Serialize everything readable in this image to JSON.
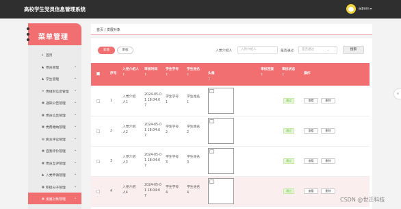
{
  "header": {
    "title": "高校学生党员信息管理系统",
    "user": "admin",
    "user_caret": "▾"
  },
  "sidebar": {
    "heading": "菜单管理",
    "items": [
      {
        "label": "首页",
        "icon": "home-icon",
        "glyph": "⌂",
        "chevron": ""
      },
      {
        "label": "党员管理",
        "icon": "user-icon",
        "glyph": "▲",
        "chevron": "⌄"
      },
      {
        "label": "学生管理",
        "icon": "user-icon",
        "glyph": "▲",
        "chevron": "⌄"
      },
      {
        "label": "党组织信息管理",
        "icon": "list-icon",
        "glyph": "≡",
        "chevron": "⌄"
      },
      {
        "label": "通知公告管理",
        "icon": "grid-icon",
        "glyph": "▦",
        "chevron": "⌄"
      },
      {
        "label": "党员信息管理",
        "icon": "grid-icon",
        "glyph": "▦",
        "chevron": "⌄"
      },
      {
        "label": "党费缴纳管理",
        "icon": "grid-icon",
        "glyph": "▦",
        "chevron": "⌄"
      },
      {
        "label": "民主评议管理",
        "icon": "doc-icon",
        "glyph": "▤",
        "chevron": "⌄"
      },
      {
        "label": "自我评价管理",
        "icon": "grid-icon",
        "glyph": "▦",
        "chevron": "⌄"
      },
      {
        "label": "党员互评管理",
        "icon": "grid-icon",
        "glyph": "▦",
        "chevron": "⌄"
      },
      {
        "label": "入党申请管理",
        "icon": "user-icon",
        "glyph": "▲",
        "chevron": "⌄"
      },
      {
        "label": "积极分子管理",
        "icon": "grid-icon",
        "glyph": "▦",
        "chevron": "⌄"
      },
      {
        "label": "发展对象管理",
        "icon": "grid-icon",
        "glyph": "▦",
        "chevron": "⌄"
      }
    ]
  },
  "breadcrumb": "首页 / 发展对象",
  "toolbar": {
    "add": "新增",
    "review": "审核",
    "introducer_label": "入党介绍人",
    "introducer_placeholder": "入党介绍人",
    "passed_label": "是否通过",
    "passed_placeholder": "是否通过",
    "search": "搜索"
  },
  "table": {
    "headers": {
      "index": "序号",
      "introducer": "入党介绍人",
      "time": "审核时间",
      "student_id": "学生学号",
      "student_name": "学生姓名",
      "avatar": "头像",
      "reply": "审核回复",
      "status": "审核状态",
      "actions": "操作"
    },
    "sort_glyph": "↕",
    "rows": [
      {
        "index": "1",
        "introducer": [
          "入党介绍",
          "人1"
        ],
        "time": [
          "2024-05-0",
          "1 18:04:0",
          "7"
        ],
        "student_id": [
          "学生学号",
          "1"
        ],
        "student_name": [
          "学生姓名",
          "1"
        ],
        "status": "通过",
        "view": "查看",
        "delete": "删除"
      },
      {
        "index": "2",
        "introducer": [
          "入党介绍",
          "人2"
        ],
        "time": [
          "2024-05-0",
          "1 18:04:0",
          "7"
        ],
        "student_id": [
          "学生学号",
          "2"
        ],
        "student_name": [
          "学生姓名",
          "2"
        ],
        "status": "通过",
        "view": "查看",
        "delete": "删除"
      },
      {
        "index": "3",
        "introducer": [
          "入党介绍",
          "人3"
        ],
        "time": [
          "2024-05-0",
          "1 18:04:0",
          "7"
        ],
        "student_id": [
          "学生学号",
          "3"
        ],
        "student_name": [
          "学生姓名",
          "3"
        ],
        "status": "通过",
        "view": "查看",
        "delete": "删除"
      },
      {
        "index": "4",
        "introducer": [
          "入党介绍",
          "人4"
        ],
        "time": [
          "2024-05-0",
          "1 18:04:0",
          "7"
        ],
        "student_id": [
          "学生学号",
          "4"
        ],
        "student_name": [
          "学生姓名",
          "4"
        ],
        "status": "通过",
        "view": "查看",
        "delete": "删除"
      }
    ]
  },
  "watermark": "CSDN @世迁科技",
  "colors": {
    "accent": "#f16f71",
    "topbar": "#2f2f2f",
    "status": "#67c23a"
  }
}
